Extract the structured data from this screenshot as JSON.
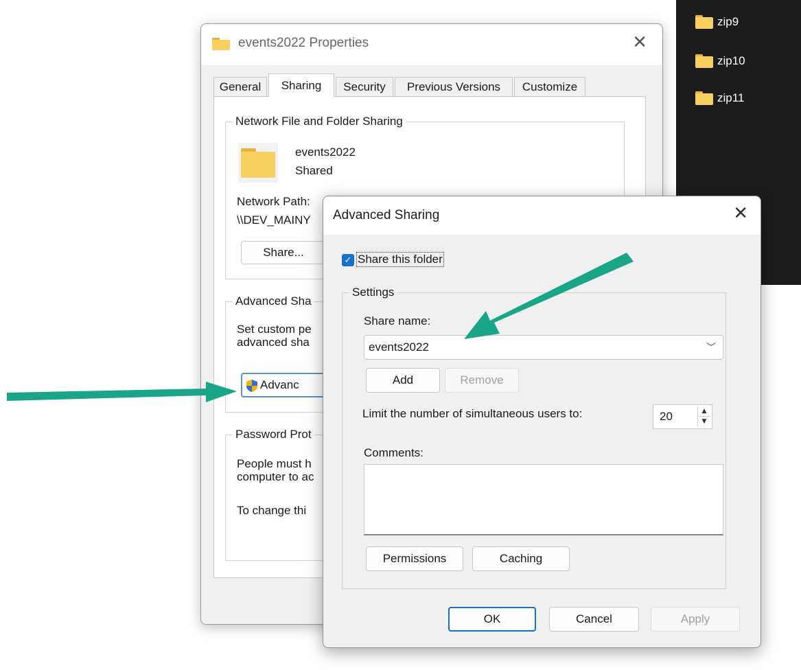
{
  "explorer": {
    "folders": [
      "zip9",
      "zip10",
      "zip11"
    ]
  },
  "properties_dialog": {
    "title": "events2022 Properties",
    "close_glyph": "✕",
    "tabs": [
      "General",
      "Sharing",
      "Security",
      "Previous Versions",
      "Customize"
    ],
    "active_tab": "Sharing",
    "network_sharing": {
      "legend": "Network File and Folder Sharing",
      "folder_name": "events2022",
      "folder_status": "Shared",
      "network_path_label": "Network Path:",
      "network_path_value": "\\\\DEV_MAINY",
      "share_button": "Share..."
    },
    "advanced_sharing": {
      "legend": "Advanced Sha",
      "text_line1": "Set custom pe",
      "text_line2": "advanced sha",
      "button": "Advanc"
    },
    "password_protection": {
      "legend": "Password Prot",
      "text_line1": "People must h",
      "text_line2": "computer to ac",
      "text_line3": "To change thi"
    }
  },
  "advanced_dialog": {
    "title": "Advanced Sharing",
    "close_glyph": "✕",
    "share_checkbox_label": "Share this folder",
    "share_checkbox_checked": true,
    "settings_legend": "Settings",
    "share_name_label": "Share name:",
    "share_name_value": "events2022",
    "add_button": "Add",
    "remove_button": "Remove",
    "limit_label": "Limit the number of simultaneous users to:",
    "limit_value": "20",
    "comments_label": "Comments:",
    "comments_value": "",
    "permissions_button": "Permissions",
    "caching_button": "Caching",
    "ok_button": "OK",
    "cancel_button": "Cancel",
    "apply_button": "Apply"
  },
  "colors": {
    "accent": "#1c6fc9",
    "annotation_arrow": "#1aa589",
    "folder": "#f8d061",
    "explorer_bg": "#1c1c1c"
  }
}
